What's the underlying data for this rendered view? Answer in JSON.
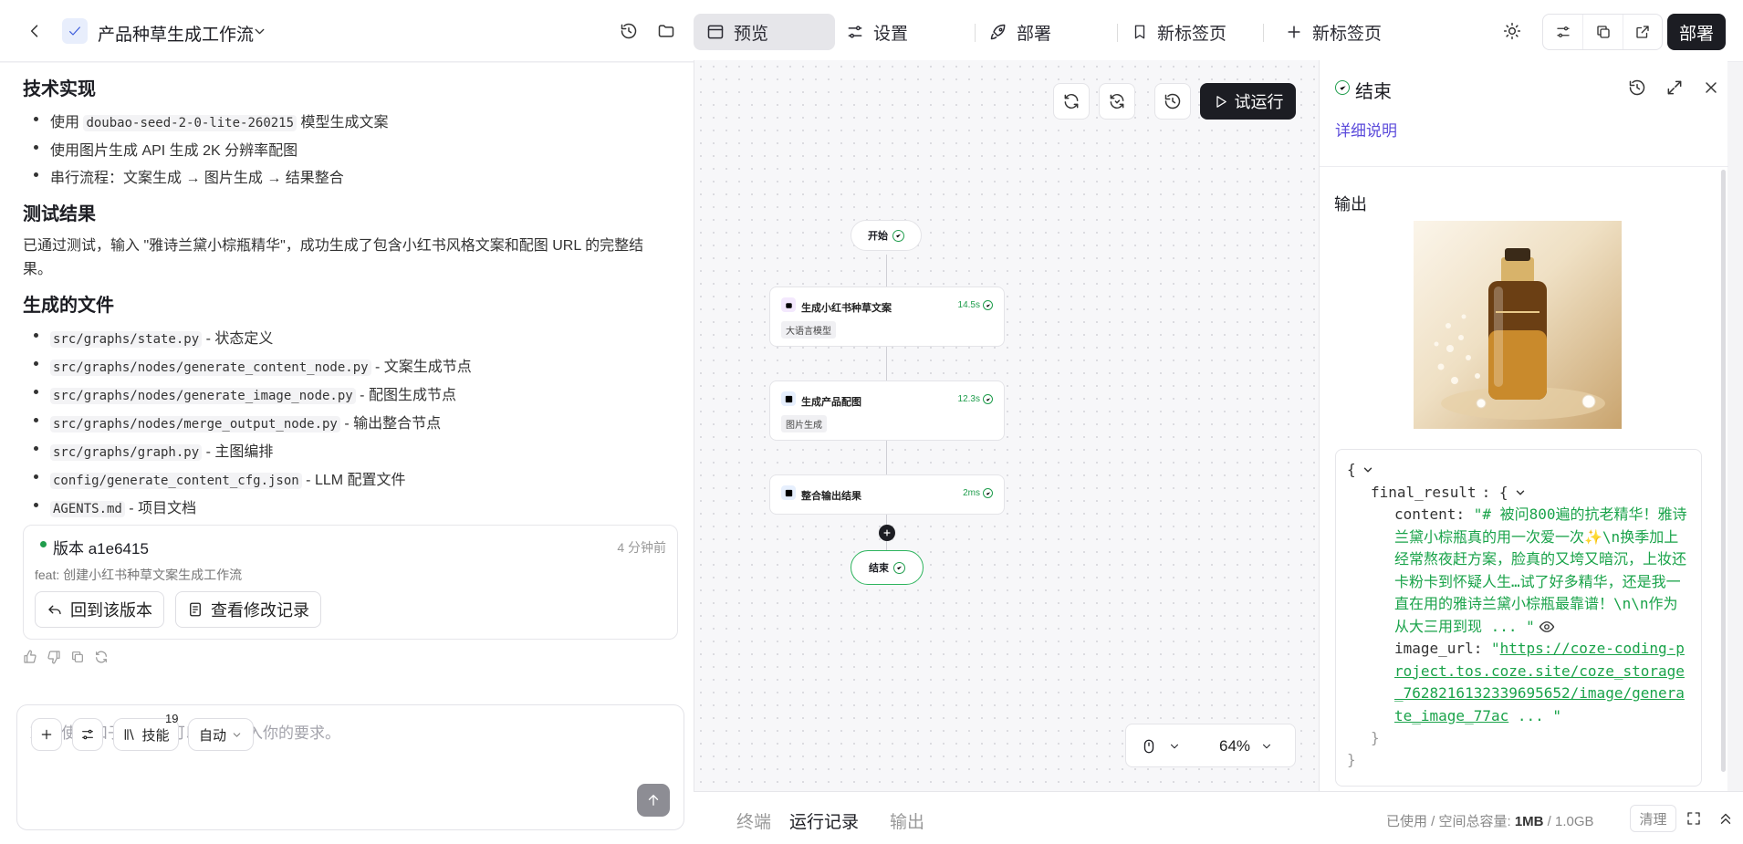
{
  "header": {
    "project_name": "产品种草生成工作流",
    "tabs": [
      {
        "label": "预览"
      },
      {
        "label": "设置"
      },
      {
        "label": "部署"
      },
      {
        "label": "新标签页"
      },
      {
        "label": "新标签页"
      }
    ],
    "deploy_label": "部署"
  },
  "chat": {
    "section1_title": "技术实现",
    "section1_items": [
      {
        "pre": "使用 ",
        "code": "doubao-seed-2-0-lite-260215",
        "post": " 模型生成文案"
      },
      {
        "pre": "使用图片生成 API 生成 2K 分辨率配图"
      },
      {
        "pre": "串行流程：文案生成 → 图片生成 → 结果整合"
      }
    ],
    "section2_title": "测试结果",
    "section2_text_line1": "已通过测试，输入 \"雅诗兰黛小棕瓶精华\"，成功生成了包含小红书风格文案和配图 URL 的完整结",
    "section2_text_line2": "果。",
    "section3_title": "生成的文件",
    "files": [
      {
        "code": "src/graphs/state.py",
        "post": " - 状态定义"
      },
      {
        "code": "src/graphs/nodes/generate_content_node.py",
        "post": " - 文案生成节点"
      },
      {
        "code": "src/graphs/nodes/generate_image_node.py",
        "post": " - 配图生成节点"
      },
      {
        "code": "src/graphs/nodes/merge_output_node.py",
        "post": " - 输出整合节点"
      },
      {
        "code": "src/graphs/graph.py",
        "post": " - 主图编排"
      },
      {
        "code": "config/generate_content_cfg.json",
        "post": " - LLM 配置文件"
      },
      {
        "code": "AGENTS.md",
        "post": " - 项目文档"
      }
    ],
    "version": {
      "title": "版本 a1e6415",
      "time": "4 分钟前",
      "message": "feat: 创建小红书种草文案生成工作流",
      "revert_label": "回到该版本",
      "history_label": "查看修改记录"
    },
    "composer": {
      "placeholder": "欢迎使用扣子编程，可以在此输入你的要求。",
      "skills_label": "技能",
      "skills_count": "19",
      "mode_label": "自动"
    }
  },
  "canvas": {
    "run_label": "试运行",
    "zoom": "64%",
    "nodes": [
      {
        "title": "开始"
      },
      {
        "title": "生成小红书种草文案",
        "time": "14.5s",
        "tag": "大语言模型"
      },
      {
        "title": "生成产品配图",
        "time": "12.3s",
        "tag": "图片生成"
      },
      {
        "title": "整合输出结果",
        "time": "2ms"
      },
      {
        "title": "结束"
      }
    ]
  },
  "bottom": {
    "tabs": [
      {
        "label": "终端"
      },
      {
        "label": "运行记录"
      },
      {
        "label": "输出"
      }
    ],
    "storage_label": "已使用 / 空间总容量: ",
    "storage_used": "1MB",
    "storage_sep": " / ",
    "storage_total": "1.0GB",
    "clear_label": "清理"
  },
  "panel": {
    "title": "结束",
    "detail_link": "详细说明",
    "output_label": "输出",
    "json": {
      "key_root": "final_result",
      "content_key": "content",
      "content_lines": [
        "\"# 被问800遍的抗老精华！雅诗",
        "兰黛小棕瓶真的用一次爱一次✨\\n换季加上",
        "经常熬夜赶方案，脸真的又垮又暗沉，上妆还",
        "卡粉卡到怀疑人生…试了好多精华，还是我一",
        "直在用的雅诗兰黛小棕瓶最靠谱！\\n\\n作为",
        "从大三用到现 ... \""
      ],
      "image_key": "image_url",
      "image_lines": [
        "https://coze-coding-p",
        "roject.tos.coze.site/coze_storage",
        "_7628216132339695652/image/genera",
        "te_image_77ac"
      ],
      "image_tail": " ... \""
    }
  },
  "colors": {
    "success": "#1f9d4c",
    "link": "#5b4bdb",
    "dark": "#1c1d23"
  }
}
